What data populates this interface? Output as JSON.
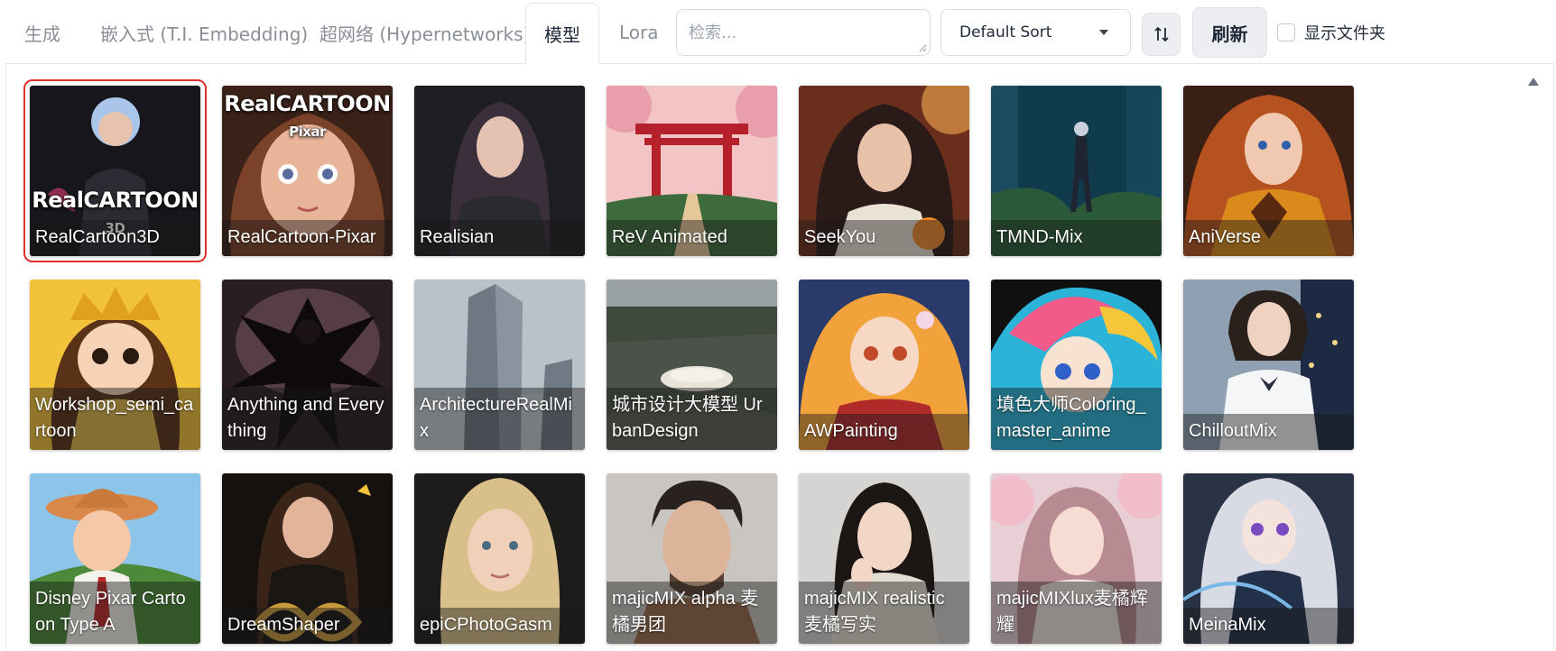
{
  "tabs": [
    {
      "label": "生成",
      "active": false
    },
    {
      "label": "嵌入式 (T.I. Embedding)",
      "active": false
    },
    {
      "label": "超网络 (Hypernetworks)",
      "active": false
    },
    {
      "label": "模型",
      "active": true
    },
    {
      "label": "Lora",
      "active": false
    }
  ],
  "search": {
    "placeholder": "检索...",
    "value": ""
  },
  "sort": {
    "selected": "Default Sort"
  },
  "sort_direction_icon": "sort-arrows-icon",
  "refresh_label": "刷新",
  "show_dirs_label": "显示文件夹",
  "selected_model": "RealCartoon3D",
  "cards": [
    {
      "label": "RealCartoon3D",
      "brand": "RealCARTOON",
      "brand_sub": "3D"
    },
    {
      "label": "RealCartoon-Pixar",
      "brand": "RealCARTOON",
      "brand_sub": "Pixar"
    },
    {
      "label": "Realisian"
    },
    {
      "label": "ReV Animated"
    },
    {
      "label": "SeekYou"
    },
    {
      "label": "TMND-Mix"
    },
    {
      "label": "AniVerse"
    },
    {
      "label": "Workshop_semi_cartoon"
    },
    {
      "label": "Anything and Everything"
    },
    {
      "label": "ArchitectureRealMix"
    },
    {
      "label": "城市设计大模型 UrbanDesign"
    },
    {
      "label": "AWPainting"
    },
    {
      "label": "填色大师Coloring_master_anime"
    },
    {
      "label": "ChilloutMix"
    },
    {
      "label": "Disney Pixar Cartoon Type A"
    },
    {
      "label": "DreamShaper"
    },
    {
      "label": "epiCPhotoGasm"
    },
    {
      "label": "majicMIX alpha 麦橘男团"
    },
    {
      "label": "majicMIX realistic 麦橘写实"
    },
    {
      "label": "majicMIXlux麦橘辉耀"
    },
    {
      "label": "MeinaMix"
    }
  ]
}
